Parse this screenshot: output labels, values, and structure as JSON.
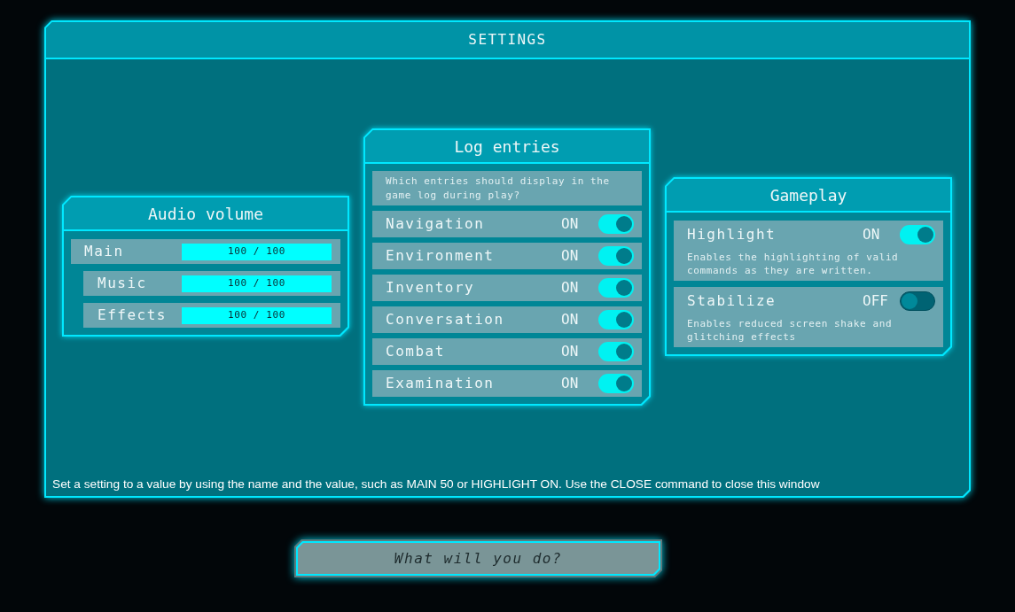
{
  "window": {
    "title": "SETTINGS"
  },
  "audio_volume": {
    "title": "Audio volume",
    "channels": [
      {
        "name": "Main",
        "level": 1,
        "reading": "100 / 100",
        "children": [
          {
            "name": "Music",
            "level": 1,
            "reading": "100 / 100"
          },
          {
            "name": "Effects",
            "level": 1,
            "reading": "100 / 100"
          }
        ]
      }
    ]
  },
  "log_entries": {
    "title": "Log entries",
    "description": "Which entries should display in the game log during play?",
    "entries": [
      {
        "label": "Navigation",
        "value": "ON",
        "on": true
      },
      {
        "label": "Environment",
        "value": "ON",
        "on": true
      },
      {
        "label": "Inventory",
        "value": "ON",
        "on": true
      },
      {
        "label": "Conversation",
        "value": "ON",
        "on": true
      },
      {
        "label": "Combat",
        "value": "ON",
        "on": true
      },
      {
        "label": "Examination",
        "value": "ON",
        "on": true
      }
    ]
  },
  "gameplay": {
    "title": "Gameplay",
    "options": [
      {
        "label": "Highlight",
        "value": "ON",
        "on": true,
        "description": "Enables the highlighting of valid commands as they are written."
      },
      {
        "label": "Stabilize",
        "value": "OFF",
        "on": false,
        "description": "Enables reduced screen shake and glitching effects"
      }
    ]
  },
  "hint": "Set a setting to a value by using the name and the value, such as MAIN 50 or HIGHLIGHT ON. Use the CLOSE command to close this window",
  "command_input": {
    "placeholder": "What will you do?"
  }
}
